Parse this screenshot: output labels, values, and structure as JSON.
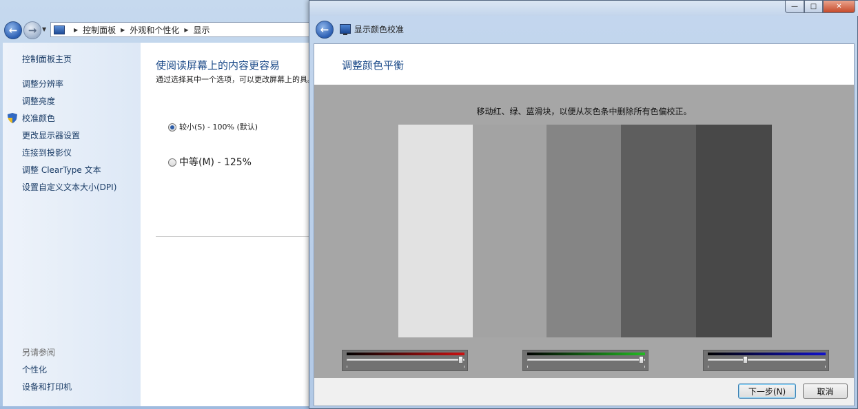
{
  "control_panel": {
    "breadcrumb": [
      "控制面板",
      "外观和个性化",
      "显示"
    ],
    "sidebar": {
      "home": "控制面板主页",
      "items": [
        "调整分辨率",
        "调整亮度",
        "校准颜色",
        "更改显示器设置",
        "连接到投影仪",
        "调整 ClearType 文本",
        "设置自定义文本大小(DPI)"
      ],
      "see_also_heading": "另请参阅",
      "see_also": [
        "个性化",
        "设备和打印机"
      ]
    },
    "main": {
      "title": "使阅读屏幕上的内容更容易",
      "description": "通过选择其中一个选项，可以更改屏幕上的具。",
      "options": [
        {
          "label": "较小(S) - 100% (默认)",
          "selected": true
        },
        {
          "label": "中等(M) - 125%",
          "selected": false
        }
      ]
    }
  },
  "dialog": {
    "title": "显示颜色校准",
    "heading": "调整颜色平衡",
    "instruction": "移动红、绿、蓝滑块，以便从灰色条中删除所有色偏校正。",
    "gray_bars": [
      "#e2e2e2",
      "#a3a3a3",
      "#858585",
      "#5e5e5e",
      "#484848"
    ],
    "sliders": [
      {
        "name": "red",
        "color": "#cc1111",
        "value": 0.97
      },
      {
        "name": "green",
        "color": "#22bb22",
        "value": 0.97
      },
      {
        "name": "blue",
        "color": "#1111cc",
        "value": 0.32
      }
    ],
    "buttons": {
      "next": "下一步(N)",
      "cancel": "取消"
    },
    "caption": {
      "min": "—",
      "max": "□",
      "close": "✕"
    }
  },
  "icons": {
    "back": "back-arrow-icon",
    "forward": "forward-arrow-icon",
    "shield": "uac-shield-icon",
    "display": "display-monitor-icon"
  }
}
